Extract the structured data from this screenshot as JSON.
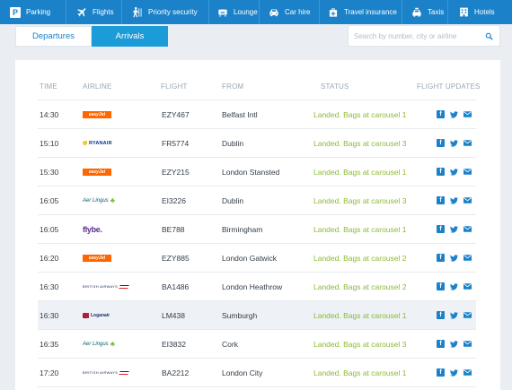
{
  "nav": [
    {
      "label": "Parking",
      "icon": "parking-icon"
    },
    {
      "label": "Flights",
      "icon": "plane-icon"
    },
    {
      "label": "Priority security",
      "icon": "security-icon"
    },
    {
      "label": "Lounge",
      "icon": "lounge-icon"
    },
    {
      "label": "Car hire",
      "icon": "car-icon"
    },
    {
      "label": "Travel insurance",
      "icon": "insurance-icon"
    },
    {
      "label": "Taxis",
      "icon": "taxi-icon"
    },
    {
      "label": "Hotels",
      "icon": "hotel-icon"
    }
  ],
  "tabs": {
    "departures": "Departures",
    "arrivals": "Arrivals",
    "active": "arrivals"
  },
  "search": {
    "placeholder": "Search by number, city or airline",
    "value": ""
  },
  "table": {
    "headers": {
      "time": "TIME",
      "airline": "AIRLINE",
      "flight": "FLIGHT",
      "from": "FROM",
      "status": "STATUS",
      "updates": "FLIGHT UPDATES"
    },
    "rows": [
      {
        "time": "14:30",
        "airline": "easyJet",
        "logo": "easyjet",
        "flight": "EZY467",
        "from": "Belfast Intl",
        "status": "Landed. Bags at carousel 1"
      },
      {
        "time": "15:10",
        "airline": "RYANAIR",
        "logo": "ryanair",
        "flight": "FR5774",
        "from": "Dublin",
        "status": "Landed. Bags at carousel 3"
      },
      {
        "time": "15:30",
        "airline": "easyJet",
        "logo": "easyjet",
        "flight": "EZY215",
        "from": "London Stansted",
        "status": "Landed. Bags at carousel 1"
      },
      {
        "time": "16:05",
        "airline": "Aer Lingus",
        "logo": "aer",
        "flight": "EI3226",
        "from": "Dublin",
        "status": "Landed. Bags at carousel 3"
      },
      {
        "time": "16:05",
        "airline": "flybe.",
        "logo": "flybe",
        "flight": "BE788",
        "from": "Birmingham",
        "status": "Landed. Bags at carousel 1"
      },
      {
        "time": "16:20",
        "airline": "easyJet",
        "logo": "easyjet",
        "flight": "EZY885",
        "from": "London Gatwick",
        "status": "Landed. Bags at carousel 2"
      },
      {
        "time": "16:30",
        "airline": "BRITISH AIRWAYS",
        "logo": "ba",
        "flight": "BA1486",
        "from": "London Heathrow",
        "status": "Landed. Bags at carousel 2"
      },
      {
        "time": "16:30",
        "airline": "Loganair",
        "logo": "loganair",
        "flight": "LM438",
        "from": "Sumburgh",
        "status": "Landed. Bags at carousel 1",
        "highlighted": true
      },
      {
        "time": "16:35",
        "airline": "Aer Lingus",
        "logo": "aer",
        "flight": "EI3832",
        "from": "Cork",
        "status": "Landed. Bags at carousel 3"
      },
      {
        "time": "17:20",
        "airline": "BRITISH AIRWAYS",
        "logo": "ba",
        "flight": "BA2212",
        "from": "London City",
        "status": "Landed. Bags at carousel 1"
      }
    ]
  },
  "colors": {
    "brand": "#1b82c9",
    "tab_active": "#1b9bd8",
    "status": "#8cbb34",
    "background": "#eaeef2"
  }
}
